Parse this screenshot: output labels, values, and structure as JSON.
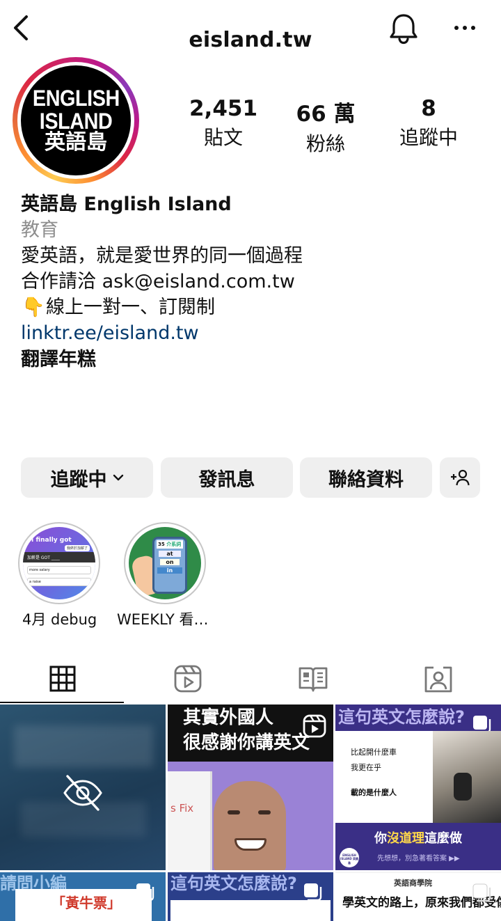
{
  "header": {
    "username": "eisland.tw"
  },
  "avatar": {
    "line1": "ENGLISH",
    "line2": "ISLAND",
    "line3": "英語島"
  },
  "stats": [
    {
      "value": "2,451",
      "label": "貼文"
    },
    {
      "value": "66 萬",
      "label": "粉絲"
    },
    {
      "value": "8",
      "label": "追蹤中"
    }
  ],
  "bio": {
    "name": "英語島 English Island",
    "category": "教育",
    "line1": "愛英語，就是愛世界的同一個過程",
    "line2": "合作請洽 ask@eisland.com.tw",
    "hand": "👇",
    "line3": "線上一對一、訂閱制",
    "link": "linktr.ee/eisland.tw",
    "extra": "翻譯年糕"
  },
  "buttons": {
    "following": "追蹤中",
    "message": "發訊息",
    "contact": "聯絡資料"
  },
  "highlights": [
    {
      "label": "4月 debug",
      "thumb_title": "I finally got",
      "thumb_sub": "我終於加薪了",
      "thumb_box": "加薪是 GOT ____",
      "opt_a": "more salary",
      "opt_b": "a raise"
    },
    {
      "label": "WEEKLY 看…",
      "thumb_num": "35",
      "thumb_tag": "介系詞",
      "w1": "at",
      "w2": "on",
      "w3": "in"
    }
  ],
  "tabs": [
    "grid",
    "reels",
    "guides",
    "tagged"
  ],
  "posts": [
    {
      "kind": "hidden"
    },
    {
      "kind": "reel",
      "top1": "其實外國人",
      "top2": "很感謝你講英文",
      "board": "s Fix"
    },
    {
      "kind": "image",
      "title": "這句英文怎麼說?",
      "p1": "比起開什麼車",
      "p2": "我更在乎",
      "p3": "載的是什麼人",
      "banner_a": "你",
      "banner_b": "沒道理",
      "banner_c": "這麼做",
      "sub": "先想想，別急著看答案 ▶▶",
      "logo": "ENGLISH ISLAND 英語島"
    },
    {
      "kind": "image",
      "title": "請問小編",
      "chip": "「黃牛票」"
    },
    {
      "kind": "image",
      "title": "這句英文怎麼說?"
    },
    {
      "kind": "image",
      "brand": "英語商學院",
      "title": "學英文的路上，原來我們都受傷了"
    }
  ]
}
